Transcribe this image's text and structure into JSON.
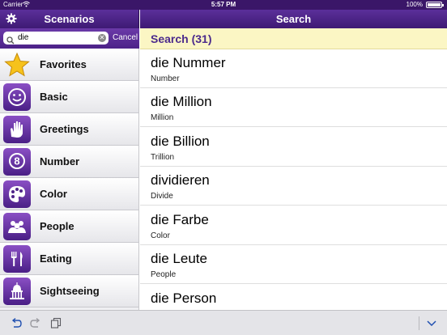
{
  "status_bar": {
    "carrier": "Carrier",
    "time": "5:57 PM",
    "battery": "100%"
  },
  "left_nav": {
    "title": "Scenarios",
    "icon": "gear-icon"
  },
  "right_nav": {
    "title": "Search"
  },
  "search": {
    "value": "die",
    "cancel_label": "Cancel"
  },
  "results_header": "Search (31)",
  "scenarios": [
    {
      "label": "Favorites",
      "icon": "star-icon"
    },
    {
      "label": "Basic",
      "icon": "smiley-icon"
    },
    {
      "label": "Greetings",
      "icon": "hand-icon"
    },
    {
      "label": "Number",
      "icon": "number-icon"
    },
    {
      "label": "Color",
      "icon": "palette-icon"
    },
    {
      "label": "People",
      "icon": "people-icon"
    },
    {
      "label": "Eating",
      "icon": "utensils-icon"
    },
    {
      "label": "Sightseeing",
      "icon": "landmark-icon"
    }
  ],
  "results": [
    {
      "word": "die Nummer",
      "translation": "Number"
    },
    {
      "word": "die Million",
      "translation": "Million"
    },
    {
      "word": "die Billion",
      "translation": "Trillion"
    },
    {
      "word": "dividieren",
      "translation": "Divide"
    },
    {
      "word": "die Farbe",
      "translation": "Color"
    },
    {
      "word": "die Leute",
      "translation": "People"
    },
    {
      "word": "die Person",
      "translation": ""
    }
  ],
  "colors": {
    "nav_purple": "#4e2488",
    "header_yellow": "#fbf6c4",
    "header_text": "#4b2a8c",
    "star_yellow": "#f6c21c"
  }
}
